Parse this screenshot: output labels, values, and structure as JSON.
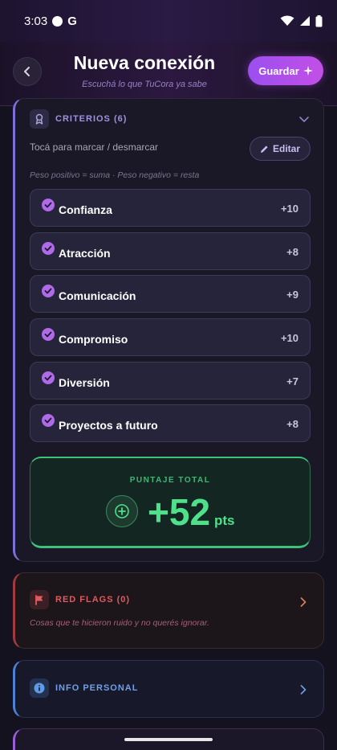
{
  "status_bar": {
    "time": "3:03",
    "carrier_icon": "google-g"
  },
  "header": {
    "title": "Nueva conexión",
    "subtitle": "Escuchá lo que TuCora ya sabe",
    "save_label": "Guardar",
    "save_icon": "sparkle-icon"
  },
  "criteria": {
    "title": "CRITERIOS (6)",
    "hint": "Tocá para marcar / desmarcar",
    "edit_label": "Editar",
    "weight_note": "Peso positivo = suma · Peso negativo = resta",
    "items": [
      {
        "label": "Confianza",
        "score": "+10",
        "checked": true
      },
      {
        "label": "Atracción",
        "score": "+8",
        "checked": true
      },
      {
        "label": "Comunicación",
        "score": "+9",
        "checked": true
      },
      {
        "label": "Compromiso",
        "score": "+10",
        "checked": true
      },
      {
        "label": "Diversión",
        "score": "+7",
        "checked": true
      },
      {
        "label": "Proyectos a futuro",
        "score": "+8",
        "checked": true
      }
    ],
    "total_label": "PUNTAJE TOTAL",
    "total_value": "+52",
    "total_unit": "pts"
  },
  "red_flags": {
    "title": "RED FLAGS (0)",
    "description": "Cosas que te hicieron ruido y no querés ignorar."
  },
  "info_personal": {
    "title": "INFO PERSONAL"
  },
  "colors": {
    "accent_purple": "#9b4ff0",
    "check_purple": "#b06ae8",
    "total_green": "#4ee08a",
    "red_flag": "#e05a5e",
    "info_blue": "#5f9ae6"
  }
}
